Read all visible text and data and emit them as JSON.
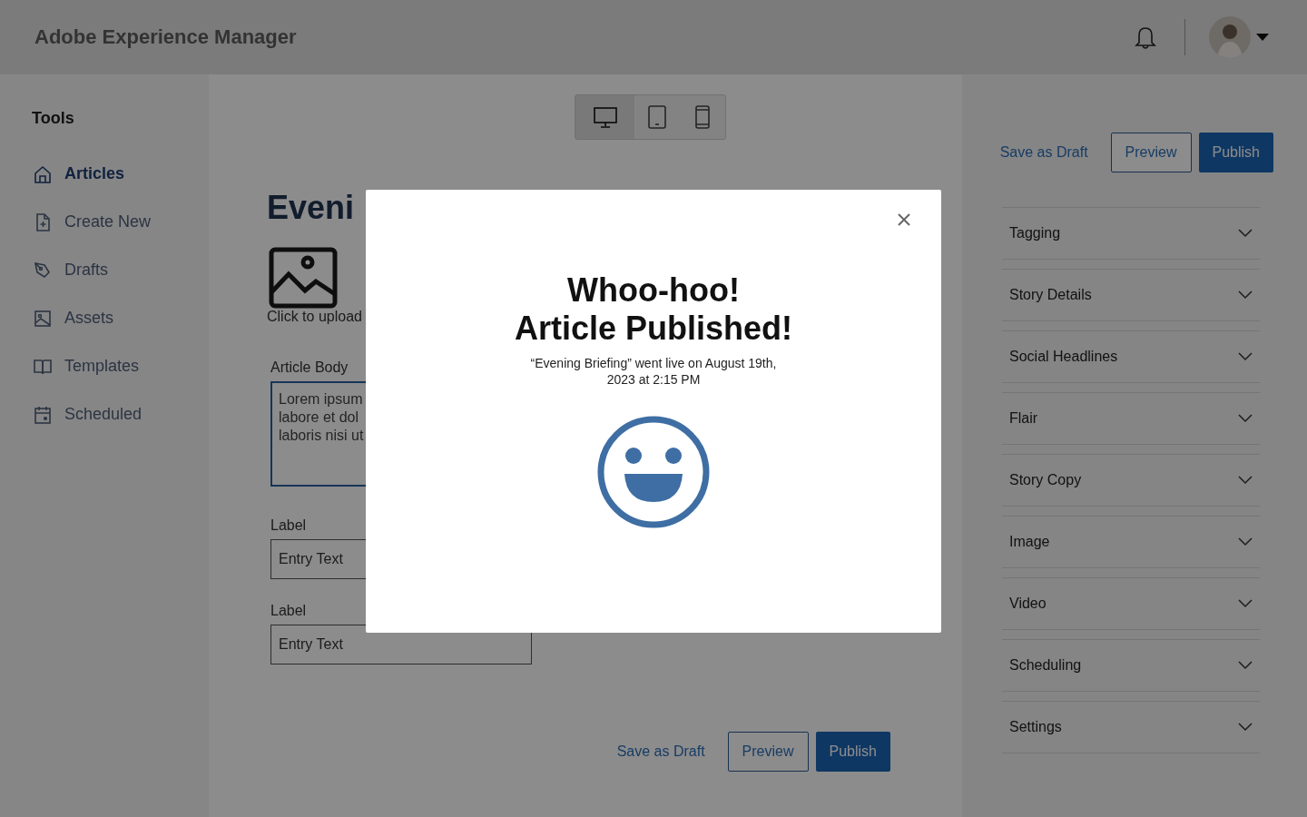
{
  "header": {
    "title": "Adobe Experience Manager"
  },
  "sidebar": {
    "heading": "Tools",
    "items": [
      {
        "label": "Articles",
        "selected": true
      },
      {
        "label": "Create New",
        "selected": false
      },
      {
        "label": "Drafts",
        "selected": false
      },
      {
        "label": "Assets",
        "selected": false
      },
      {
        "label": "Templates",
        "selected": false
      },
      {
        "label": "Scheduled",
        "selected": false
      }
    ]
  },
  "device_toggle": [
    {
      "selected": true
    },
    {
      "selected": false
    },
    {
      "selected": false
    }
  ],
  "editor": {
    "title": "Eveni",
    "upload_label": "Click to upload",
    "body_label": "Article Body",
    "body_lines": [
      "Lorem ipsum",
      "labore et dol",
      "laboris nisi ut"
    ],
    "fields": [
      {
        "label": "Label",
        "value": "Entry Text"
      },
      {
        "label": "Label",
        "value": "Entry Text"
      }
    ],
    "actions": {
      "save_draft": "Save as Draft",
      "preview": "Preview",
      "publish": "Publish"
    }
  },
  "side_panel": {
    "actions": {
      "save_draft": "Save as Draft",
      "preview": "Preview",
      "publish": "Publish"
    },
    "sections": [
      {
        "label": "Tagging",
        "expanded": false
      },
      {
        "label": "Story Details",
        "expanded": false
      },
      {
        "label": "Social Headlines",
        "expanded": false
      },
      {
        "label": "Flair",
        "expanded": false
      },
      {
        "label": "Story Copy",
        "expanded": false
      },
      {
        "label": "Image",
        "expanded": false
      },
      {
        "label": "Video",
        "expanded": false
      },
      {
        "label": "Scheduling",
        "expanded": false
      },
      {
        "label": "Settings",
        "expanded": false
      }
    ]
  },
  "modal": {
    "title_lines": [
      "Whoo-hoo!",
      "Article Published!"
    ],
    "message": "“Evening Briefing” went live on August 19th, 2023 at 2:15 PM"
  }
}
